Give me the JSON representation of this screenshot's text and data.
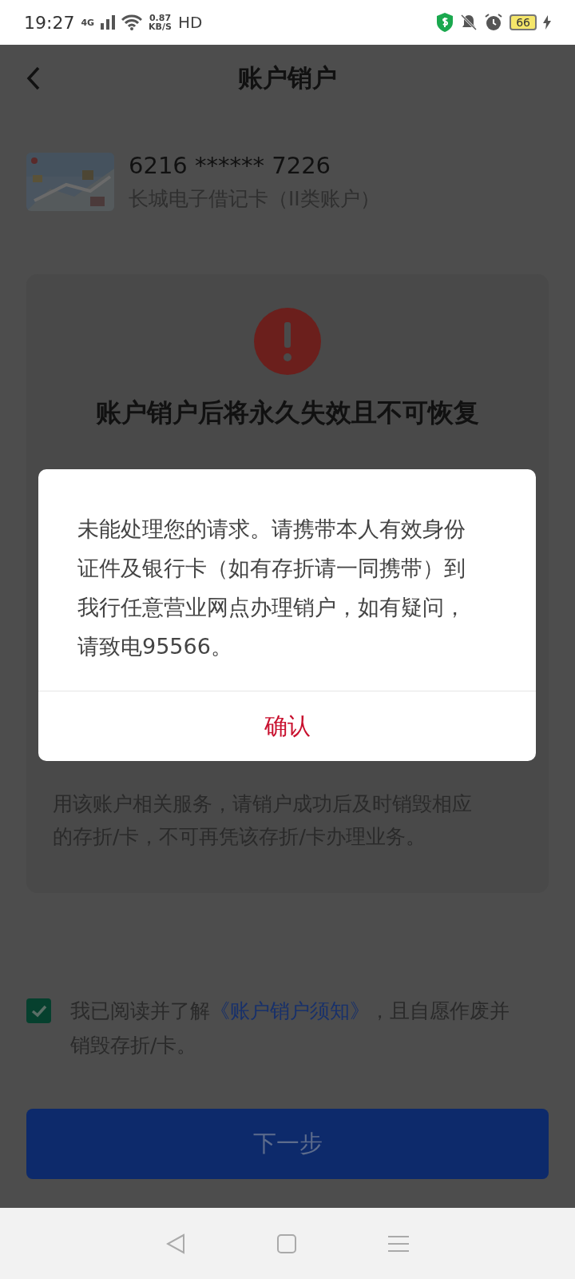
{
  "status_bar": {
    "time": "19:27",
    "network": "4G",
    "speed": "0.87",
    "speed_unit": "KB/S",
    "hd": "HD",
    "battery": "66"
  },
  "header": {
    "title": "账户销户"
  },
  "account": {
    "number": "6216 ****** 7226",
    "type": "长城电子借记卡（II类账户）"
  },
  "warning": {
    "title": "账户销户后将永久失效且不可恢复",
    "notice_lines": [
      "用该账户相关服务，请销户成功后及时销毁相应",
      "的存折/卡，不可再凭该存折/卡办理业务。"
    ]
  },
  "agreement": {
    "checked": true,
    "text_before": "我已阅读并了解",
    "link": "《账户销户须知》",
    "text_after": "，且自愿作废并销毁存折/卡。"
  },
  "next_button": {
    "label": "下一步"
  },
  "dialog": {
    "message": "未能处理您的请求。请携带本人有效身份证件及银行卡（如有存折请一同携带）到我行任意营业网点办理销户，如有疑问，请致电95566。",
    "confirm": "确认"
  }
}
